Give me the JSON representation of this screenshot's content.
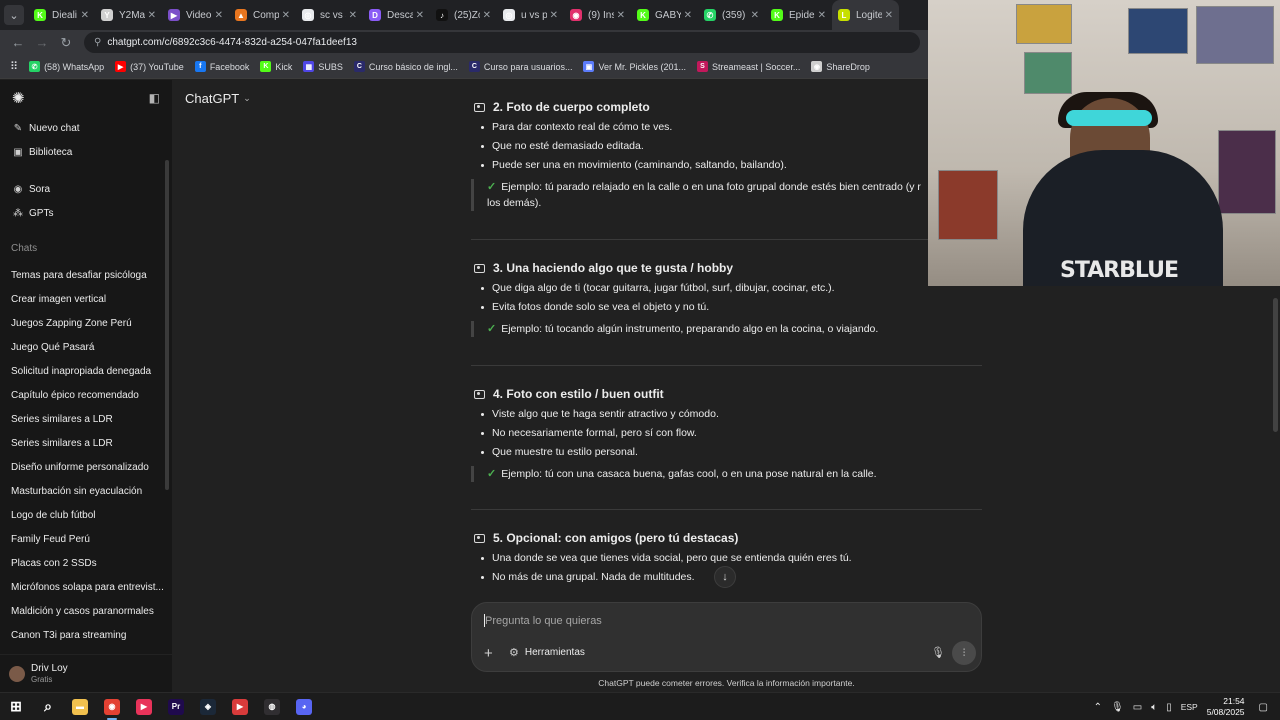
{
  "browser": {
    "tabs": [
      {
        "title": "Dieali",
        "icon_color": "#53fc18",
        "glyph": "K",
        "active": false
      },
      {
        "title": "Y2Ma",
        "icon_color": "#d0d0d0",
        "glyph": "Y",
        "active": false
      },
      {
        "title": "Video",
        "icon_color": "#7b4fc9",
        "glyph": "▶",
        "active": false
      },
      {
        "title": "Comp",
        "icon_color": "#e8761f",
        "glyph": "▲",
        "active": false
      },
      {
        "title": "sc vs a",
        "icon_color": "#e8eaed",
        "glyph": "◎",
        "active": false
      },
      {
        "title": "Desca",
        "icon_color": "#8b5cf6",
        "glyph": "D",
        "active": false
      },
      {
        "title": "(25)Zo",
        "icon_color": "#111111",
        "glyph": "♪",
        "active": false
      },
      {
        "title": "u vs p",
        "icon_color": "#e8eaed",
        "glyph": "◎",
        "active": false
      },
      {
        "title": "(9) Ins",
        "icon_color": "#e1306c",
        "glyph": "◉",
        "active": false
      },
      {
        "title": "GABY",
        "icon_color": "#53fc18",
        "glyph": "K",
        "active": false
      },
      {
        "title": "(359)",
        "icon_color": "#25d366",
        "glyph": "✆",
        "active": false
      },
      {
        "title": "Epide",
        "icon_color": "#53fc18",
        "glyph": "K",
        "active": false
      },
      {
        "title": "Logite",
        "icon_color": "#c7e000",
        "glyph": "L",
        "active": true
      }
    ],
    "url": "chatgpt.com/c/6892c3c6-4474-832d-a254-047fa1deef13",
    "bookmarks": [
      {
        "label": "(58) WhatsApp",
        "icon_color": "#25d366",
        "glyph": "✆"
      },
      {
        "label": "(37) YouTube",
        "icon_color": "#ff0000",
        "glyph": "▶"
      },
      {
        "label": "Facebook",
        "icon_color": "#1877f2",
        "glyph": "f"
      },
      {
        "label": "Kick",
        "icon_color": "#53fc18",
        "glyph": "K"
      },
      {
        "label": "SUBS",
        "icon_color": "#4f46e5",
        "glyph": "▦"
      },
      {
        "label": "Curso básico de ingl...",
        "icon_color": "#2a2a6a",
        "glyph": "C"
      },
      {
        "label": "Curso para usuarios...",
        "icon_color": "#2a2a6a",
        "glyph": "C"
      },
      {
        "label": "Ver Mr. Pickles (201...",
        "icon_color": "#5c7cfa",
        "glyph": "▣"
      },
      {
        "label": "Streameast | Soccer...",
        "icon_color": "#c2185b",
        "glyph": "S"
      },
      {
        "label": "ShareDrop",
        "icon_color": "#cfcfcf",
        "glyph": "◉"
      }
    ]
  },
  "sidebar": {
    "nav": [
      {
        "label": "Nuevo chat",
        "icon": "edit-icon",
        "glyph": "✎"
      },
      {
        "label": "Biblioteca",
        "icon": "library-icon",
        "glyph": "▣"
      },
      {
        "label": "Sora",
        "icon": "sora-icon",
        "glyph": "◉"
      },
      {
        "label": "GPTs",
        "icon": "gpts-icon",
        "glyph": "⁂"
      }
    ],
    "chats_label": "Chats",
    "chats": [
      "Temas para desafiar psicóloga",
      "Crear imagen vertical",
      "Juegos Zapping Zone Perú",
      "Juego Qué Pasará",
      "Solicitud inapropiada denegada",
      "Capítulo épico recomendado",
      "Series similares a LDR",
      "Series similares a LDR",
      "Diseño uniforme personalizado",
      "Masturbación sin eyaculación",
      "Logo de club fútbol",
      "Family Feud Perú",
      "Placas con 2 SSDs",
      "Micrófonos solapa para entrevist...",
      "Maldición y casos paranormales",
      "Canon T3i para streaming"
    ],
    "user": {
      "name": "Driv Loy",
      "plan": "Gratis"
    }
  },
  "main": {
    "model_label": "ChatGPT",
    "sections": [
      {
        "title": "2. Foto de cuerpo completo",
        "bullets": [
          "Para dar contexto real de cómo te ves.",
          "Que no esté demasiado editada.",
          "Puede ser una en movimiento (caminando, saltando, bailando)."
        ],
        "example": "Ejemplo: tú parado relajado en la calle o en una foto grupal donde estés bien centrado (y r",
        "example_cont": "los demás)."
      },
      {
        "title": "3. Una haciendo algo que te gusta / hobby",
        "bullets": [
          "Que diga algo de ti (tocar guitarra, jugar fútbol, surf, dibujar, cocinar, etc.).",
          "Evita fotos donde solo se vea el objeto y no tú."
        ],
        "example": "Ejemplo: tú tocando algún instrumento, preparando algo en la cocina, o viajando.",
        "example_cont": ""
      },
      {
        "title": "4. Foto con estilo / buen outfit",
        "bullets": [
          "Viste algo que te haga sentir atractivo y cómodo.",
          "No necesariamente formal, pero sí con flow.",
          "Que muestre tu estilo personal."
        ],
        "example": "Ejemplo: tú con una casaca buena, gafas cool, o en una pose natural en la calle.",
        "example_cont": ""
      },
      {
        "title": "5. Opcional: con amigos (pero tú destacas)",
        "bullets": [
          "Una donde se vea que tienes vida social, pero que se entienda quién eres tú.",
          "No más de una grupal. Nada de multitudes."
        ],
        "example": "",
        "example_cont": ""
      }
    ],
    "composer": {
      "placeholder": "Pregunta lo que quieras",
      "tools_label": "Herramientas"
    },
    "disclaimer": "ChatGPT puede cometer errores. Verifica la información importante."
  },
  "webcam": {
    "shirt_text": "STARBLUE"
  },
  "taskbar": {
    "apps": [
      {
        "name": "start-icon",
        "glyph": "⊞",
        "color": "#ffffff",
        "active": false
      },
      {
        "name": "search-icon",
        "glyph": "⌕",
        "color": "#ffffff",
        "active": false
      },
      {
        "name": "file-explorer-icon",
        "glyph": "▬",
        "color": "#f2c14e",
        "active": false
      },
      {
        "name": "chrome-icon",
        "glyph": "◉",
        "color": "#e34133",
        "active": true
      },
      {
        "name": "media-player-icon",
        "glyph": "▶",
        "color": "#e8335a",
        "active": false
      },
      {
        "name": "premiere-icon",
        "glyph": "Pr",
        "color": "#1f0a4d",
        "active": false
      },
      {
        "name": "steam-icon",
        "glyph": "◈",
        "color": "#1b2838",
        "active": false
      },
      {
        "name": "streamlabs-icon",
        "glyph": "▶",
        "color": "#d83b3b",
        "active": false
      },
      {
        "name": "obs-icon",
        "glyph": "◍",
        "color": "#302e31",
        "active": false
      },
      {
        "name": "discord-icon",
        "glyph": "◕",
        "color": "#5865f2",
        "active": false
      }
    ],
    "lang": "ESP",
    "time": "21:54",
    "date": "5/08/2025"
  }
}
